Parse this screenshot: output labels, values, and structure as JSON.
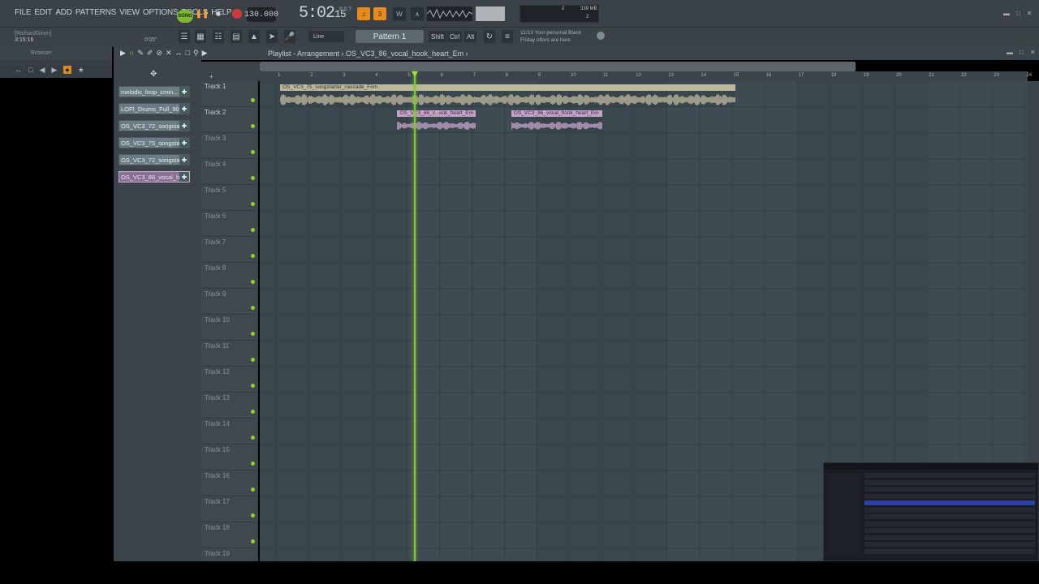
{
  "menu": [
    "FILE",
    "EDIT",
    "ADD",
    "PATTERNS",
    "VIEW",
    "OPTIONS",
    "TOOLS",
    "HELP"
  ],
  "transport": {
    "song_label": "SONG",
    "tempo": "130.000",
    "time": "5:02",
    "time_sub": "15",
    "time_small": "B:S:T"
  },
  "cpu": {
    "value": "2",
    "memory": "339 MB",
    "voices": "2"
  },
  "user": {
    "name": "[RichardGiron]",
    "time": "3:15:16",
    "hint": "0'05\""
  },
  "snap": "Line",
  "pattern": "Pattern 1",
  "keys": [
    "Shift",
    "Ctrl",
    "Alt"
  ],
  "news": {
    "line1": "11/13  Your personal Black",
    "line2": "Friday offers are here"
  },
  "browser": {
    "title": "Browser"
  },
  "channels": [
    "melodic_loop_cmin...",
    "LOFI_Drums_Full_90",
    "OS_VC3_72_songstar...",
    "OS_VC3_75_songstar...",
    "OS_VC3_72_songstar...",
    "OS_VC3_86_vocal_h..."
  ],
  "playlist": {
    "breadcrumb": "Playlist - Arrangement  ›  OS_VC3_86_vocal_hook_heart_Em  ›"
  },
  "ruler": [
    "1",
    "2",
    "3",
    "4",
    "5",
    "6",
    "7",
    "8",
    "9",
    "10",
    "11",
    "12",
    "13",
    "14",
    "15",
    "16",
    "17",
    "18",
    "19",
    "20",
    "21",
    "22",
    "23",
    "24"
  ],
  "tracks": [
    "Track 1",
    "Track 2",
    "Track 3",
    "Track 4",
    "Track 5",
    "Track 6",
    "Track 7",
    "Track 8",
    "Track 9",
    "Track 10",
    "Track 11",
    "Track 12",
    "Track 13",
    "Track 14",
    "Track 15",
    "Track 16",
    "Track 17",
    "Track 18",
    "Track 19"
  ],
  "clips": [
    {
      "title": "OS_VC3_75_songstarter_cascade_F#m",
      "track": 0,
      "start": 1,
      "end": 15,
      "color": "#bdb79c"
    },
    {
      "title": "OS_VC3_86_v...ook_heart_Em",
      "track": 1,
      "start": 4.6,
      "end": 7,
      "color": "#c3a3c8"
    },
    {
      "title": "OS_VC3_86_vocal_hook_heart_Em",
      "track": 1,
      "start": 8.1,
      "end": 10.9,
      "color": "#c3a3c8"
    }
  ],
  "playhead_bar": 5.1,
  "icons": [
    "play-icon",
    "stop-icon",
    "record-icon",
    "snap-icon",
    "brush-icon",
    "delete-icon",
    "mute-icon",
    "zoom-icon",
    "plus-icon",
    "arrow-right-icon"
  ]
}
